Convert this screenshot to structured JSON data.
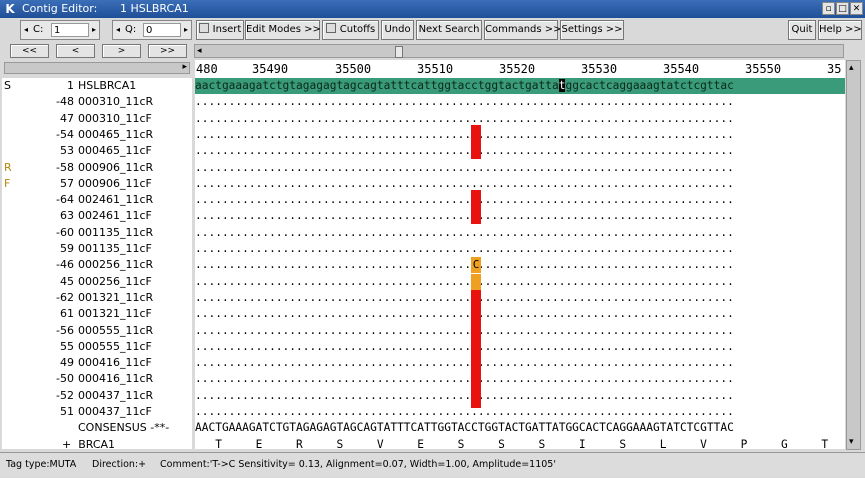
{
  "window": {
    "title": "Contig Editor:",
    "subtitle": "1 HSLBRCA1"
  },
  "toolbar": {
    "c_label": "C:",
    "c_value": "1",
    "q_label": "Q:",
    "q_value": "0",
    "insert": "Insert",
    "edit_modes": "Edit Modes >>",
    "cutoffs": "Cutoffs",
    "undo": "Undo",
    "next_search": "Next Search",
    "commands": "Commands >>",
    "settings": "Settings >>",
    "quit": "Quit",
    "help": "Help >>"
  },
  "nav": {
    "first": "<<",
    "prev": "<",
    "next": ">",
    "last": ">>"
  },
  "ruler": [
    "480",
    "35490",
    "35500",
    "35510",
    "35520",
    "35530",
    "35540",
    "35550",
    "35"
  ],
  "reference": {
    "flag": "S",
    "num": "1",
    "name": "HSLBRCA1",
    "seq": "aactgaaagatctgtagagagtagcagtatttcattggtacctggtactgattatggcactcaggaaagtatctcgttac"
  },
  "reads": [
    {
      "flag": "",
      "num": "-48",
      "name": "000310_11cR"
    },
    {
      "flag": "",
      "num": "47",
      "name": "000310_11cF"
    },
    {
      "flag": "",
      "num": "-54",
      "name": "000465_11cR"
    },
    {
      "flag": "",
      "num": "53",
      "name": "000465_11cF"
    },
    {
      "flag": "R",
      "num": "-58",
      "name": "000906_11cR"
    },
    {
      "flag": "F",
      "num": "57",
      "name": "000906_11cF"
    },
    {
      "flag": "",
      "num": "-64",
      "name": "002461_11cR"
    },
    {
      "flag": "",
      "num": "63",
      "name": "002461_11cF"
    },
    {
      "flag": "",
      "num": "-60",
      "name": "001135_11cR"
    },
    {
      "flag": "",
      "num": "59",
      "name": "001135_11cF"
    },
    {
      "flag": "",
      "num": "-46",
      "name": "000256_11cR"
    },
    {
      "flag": "",
      "num": "45",
      "name": "000256_11cF"
    },
    {
      "flag": "",
      "num": "-62",
      "name": "001321_11cR"
    },
    {
      "flag": "",
      "num": "61",
      "name": "001321_11cF"
    },
    {
      "flag": "",
      "num": "-56",
      "name": "000555_11cR"
    },
    {
      "flag": "",
      "num": "55",
      "name": "000555_11cF"
    },
    {
      "flag": "",
      "num": "49",
      "name": "000416_11cF"
    },
    {
      "flag": "",
      "num": "-50",
      "name": "000416_11cR"
    },
    {
      "flag": "",
      "num": "-52",
      "name": "000437_11cR"
    },
    {
      "flag": "",
      "num": "51",
      "name": "000437_11cF"
    }
  ],
  "consensus": {
    "label": "CONSENSUS",
    "sign": "-**-",
    "seq": "AACTGAAAGATCTGTAGAGAGTAGCAGTATTTCATTGGTACCTGGTACTGATTATGGCACTCAGGAAAGTATCTCGTTAC"
  },
  "translation": {
    "sign": "+",
    "name": "BRCA1",
    "aa": "   T     E     R     S     V     E     S     S     S     I     S     L     V     P     G     T     D     Y     G     T     Q     E     S     I     S     L"
  },
  "mismatch": {
    "base": "C",
    "highlight_color": "#e8130f",
    "tag_color": "#f0a020"
  },
  "status": {
    "tag_type": "Tag type:MUTA",
    "direction": "Direction:+",
    "comment": "Comment:'T->C Sensitivity= 0.13, Alignment=0.07, Width=1.00, Amplitude=1105'"
  },
  "colors": {
    "reference_bg": "#3a9b7a",
    "title_bg": "#2a5ea8"
  }
}
